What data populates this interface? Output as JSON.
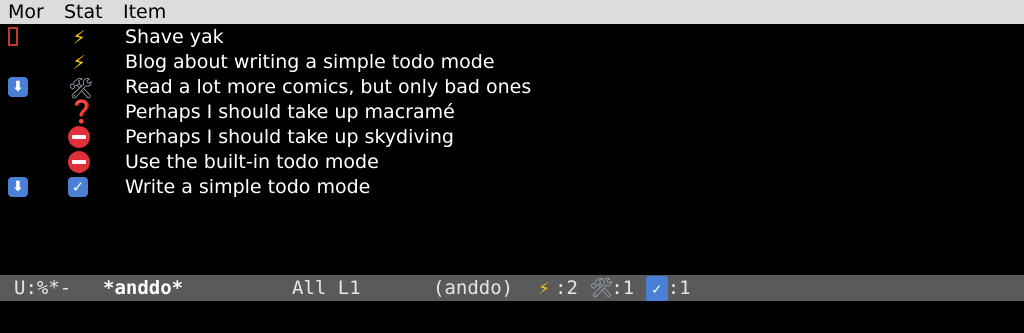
{
  "header": {
    "col_mor": "Mor",
    "col_stat": "Stat",
    "col_item": "Item"
  },
  "rows": [
    {
      "mor": "cursor",
      "stat": "bolt",
      "item": "Shave yak"
    },
    {
      "mor": "",
      "stat": "bolt",
      "item": "Blog about writing a simple todo mode"
    },
    {
      "mor": "down",
      "stat": "tools",
      "item": "Read a lot more comics, but only bad ones"
    },
    {
      "mor": "",
      "stat": "question",
      "item": "Perhaps I should take up macramé"
    },
    {
      "mor": "",
      "stat": "nogo",
      "item": "Perhaps I should take up skydiving"
    },
    {
      "mor": "",
      "stat": "nogo",
      "item": "Use the built-in todo mode"
    },
    {
      "mor": "down",
      "stat": "check",
      "item": "Write a simple todo mode"
    }
  ],
  "icons": {
    "bolt": "⚡",
    "tools": "🛠",
    "question": "❓",
    "check": "✓",
    "down": "⬇"
  },
  "mode_line": {
    "status": "U:%*-",
    "buffer_name": "*anddo*",
    "position": "All L1",
    "mode": "(anddo)",
    "bolt_count": ":2",
    "tools_count": ":1",
    "check_count": ":1"
  },
  "colors": {
    "header_bg": "#dcdcdc",
    "mode_line_bg": "#5a5a5a",
    "cursor": "#c0392b",
    "bolt": "#f5c518",
    "nogo": "#e0303a",
    "check_bg": "#4a7fd6"
  }
}
